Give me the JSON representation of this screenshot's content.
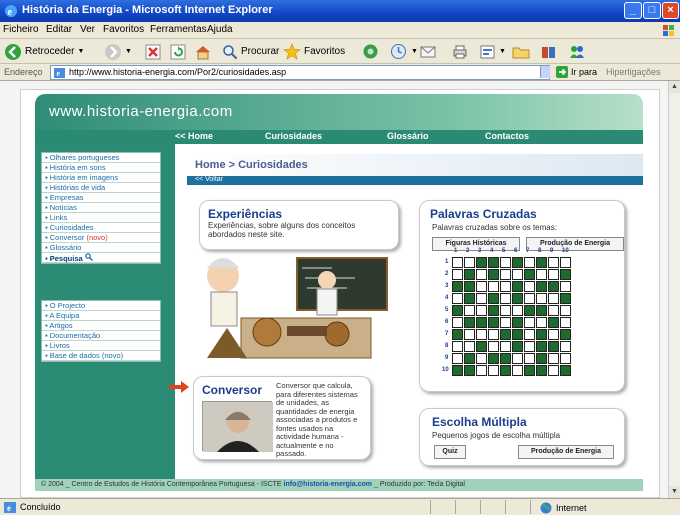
{
  "window": {
    "title": "História da Energia - Microsoft Internet Explorer"
  },
  "menu": [
    "Ficheiro",
    "Editar",
    "Ver",
    "Favoritos",
    "Ferramentas",
    "Ajuda"
  ],
  "toolbar": {
    "back": "Retroceder",
    "search": "Procurar",
    "favorites": "Favoritos"
  },
  "address": {
    "label": "Endereço",
    "url": "http://www.historia-energia.com/Por2/curiosidades.asp",
    "go": "Ir para",
    "links": "Hiperligações"
  },
  "site": {
    "brand": "www.historia-energia.com",
    "nav": [
      "<< Home",
      "Curiosidades",
      "Glossário",
      "Contactos"
    ],
    "menu1": [
      {
        "label": "Olhares portugueses"
      },
      {
        "label": "História em sons"
      },
      {
        "label": "História em imagens"
      },
      {
        "label": "Histórias de vida"
      },
      {
        "label": "Empresas"
      },
      {
        "label": "Notícias"
      },
      {
        "label": "Links"
      },
      {
        "label": "Curiosidades"
      },
      {
        "label": "Conversor",
        "badge": "(novo)"
      },
      {
        "label": "Glossário"
      },
      {
        "label": "Pesquisa"
      }
    ],
    "menu2": [
      "O Projecto",
      "A Equipa",
      "Artigos",
      "Documentação",
      "Livros",
      "Base de dados (novo)"
    ],
    "breadcrumb": "Home > Curiosidades",
    "back": "<< Voltar",
    "experiencias": {
      "title": "Experiências",
      "text": "Experiências, sobre alguns dos conceitos abordados neste site."
    },
    "palavras": {
      "title": "Palavras Cruzadas",
      "text": "Palavras cruzadas sobre  os temas:",
      "btn1": "Figuras Históricas",
      "btn2": "Produção de Energia"
    },
    "conversor": {
      "title": "Conversor",
      "text": "Conversor que calcula, para diferentes sistemas de unidades, as quantidades de energia associadas a produtos e fontes usados na actividade humana - actualmente e no passado."
    },
    "escolha": {
      "title": "Escolha Múltipla",
      "text": "Pequenos jogos de escolha múltipla",
      "btn1": "Quiz",
      "btn2": "Produção de Energia"
    },
    "footer_text": "© 2004 _ Centro de Estudos de História Contemporânea Portuguesa - ISCTE ",
    "footer_email": "info@historia-energia.com",
    "footer_right": " _ Produzido por: Tecla Digital",
    "colnums": [
      "1",
      "2",
      "3",
      "4",
      "5",
      "6",
      "7",
      "8",
      "9",
      "10"
    ],
    "rownums": [
      "1",
      "2",
      "3",
      "4",
      "5",
      "6",
      "7",
      "8",
      "9",
      "10"
    ]
  },
  "status": {
    "left": "Concluído",
    "zone": "Internet"
  },
  "colors": {
    "accent": "#2c8b75",
    "titlebar": "#1046c8"
  }
}
